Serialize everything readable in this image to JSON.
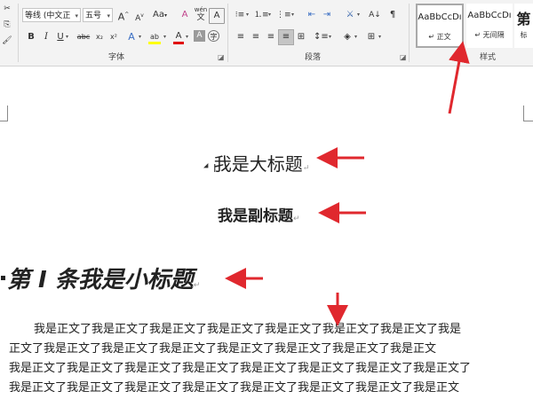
{
  "ribbon": {
    "font_group_label": "字体",
    "paragraph_group_label": "段落",
    "styles_group_label": "样式",
    "font_name": "等线 (中文正 ",
    "font_size": "五号",
    "grow_font": "A",
    "shrink_font": "A",
    "change_case": "Aa",
    "clear_format": "A",
    "phonetic_top": "wén",
    "phonetic_bottom": "文",
    "bold": "B",
    "italic": "I",
    "underline": "U",
    "strikethrough": "abc",
    "subscript": "x₂",
    "superscript": "x²",
    "text_effect": "A",
    "highlight": "ab",
    "font_color": "A",
    "char_shading": "A",
    "enclose_char": "字",
    "styles": [
      {
        "sample": "AaBbCcDı",
        "name": "↵ 正文"
      },
      {
        "sample": "AaBbCcDı",
        "name": "↵ 无间隔"
      },
      {
        "sample": "第",
        "name": "标"
      }
    ]
  },
  "document": {
    "title": "我是大标题",
    "subtitle": "我是副标题",
    "section_heading": "第 I 条我是小标题",
    "paragraph_mark": "↵",
    "body_lines": [
      "我是正文了我是正文了我是正文了我是正文了我是正文了我是正文了我是正文了我是",
      "正文了我是正文了我是正文了我是正文了我是正文了我是正文了我是正文了我是正文",
      "我是正文了我是正文了我是正文了我是正文了我是正文了我是正文了我是正文了我是正文了",
      "我是正文了我是正文了我是正文了我是正文了我是正文了我是正文了我是正文了我是正文"
    ]
  },
  "colors": {
    "annotation_arrow": "#e0282e",
    "ribbon_bg": "#f3f3f3",
    "highlight_yellow": "#ffff00",
    "font_red": "#e00000"
  }
}
